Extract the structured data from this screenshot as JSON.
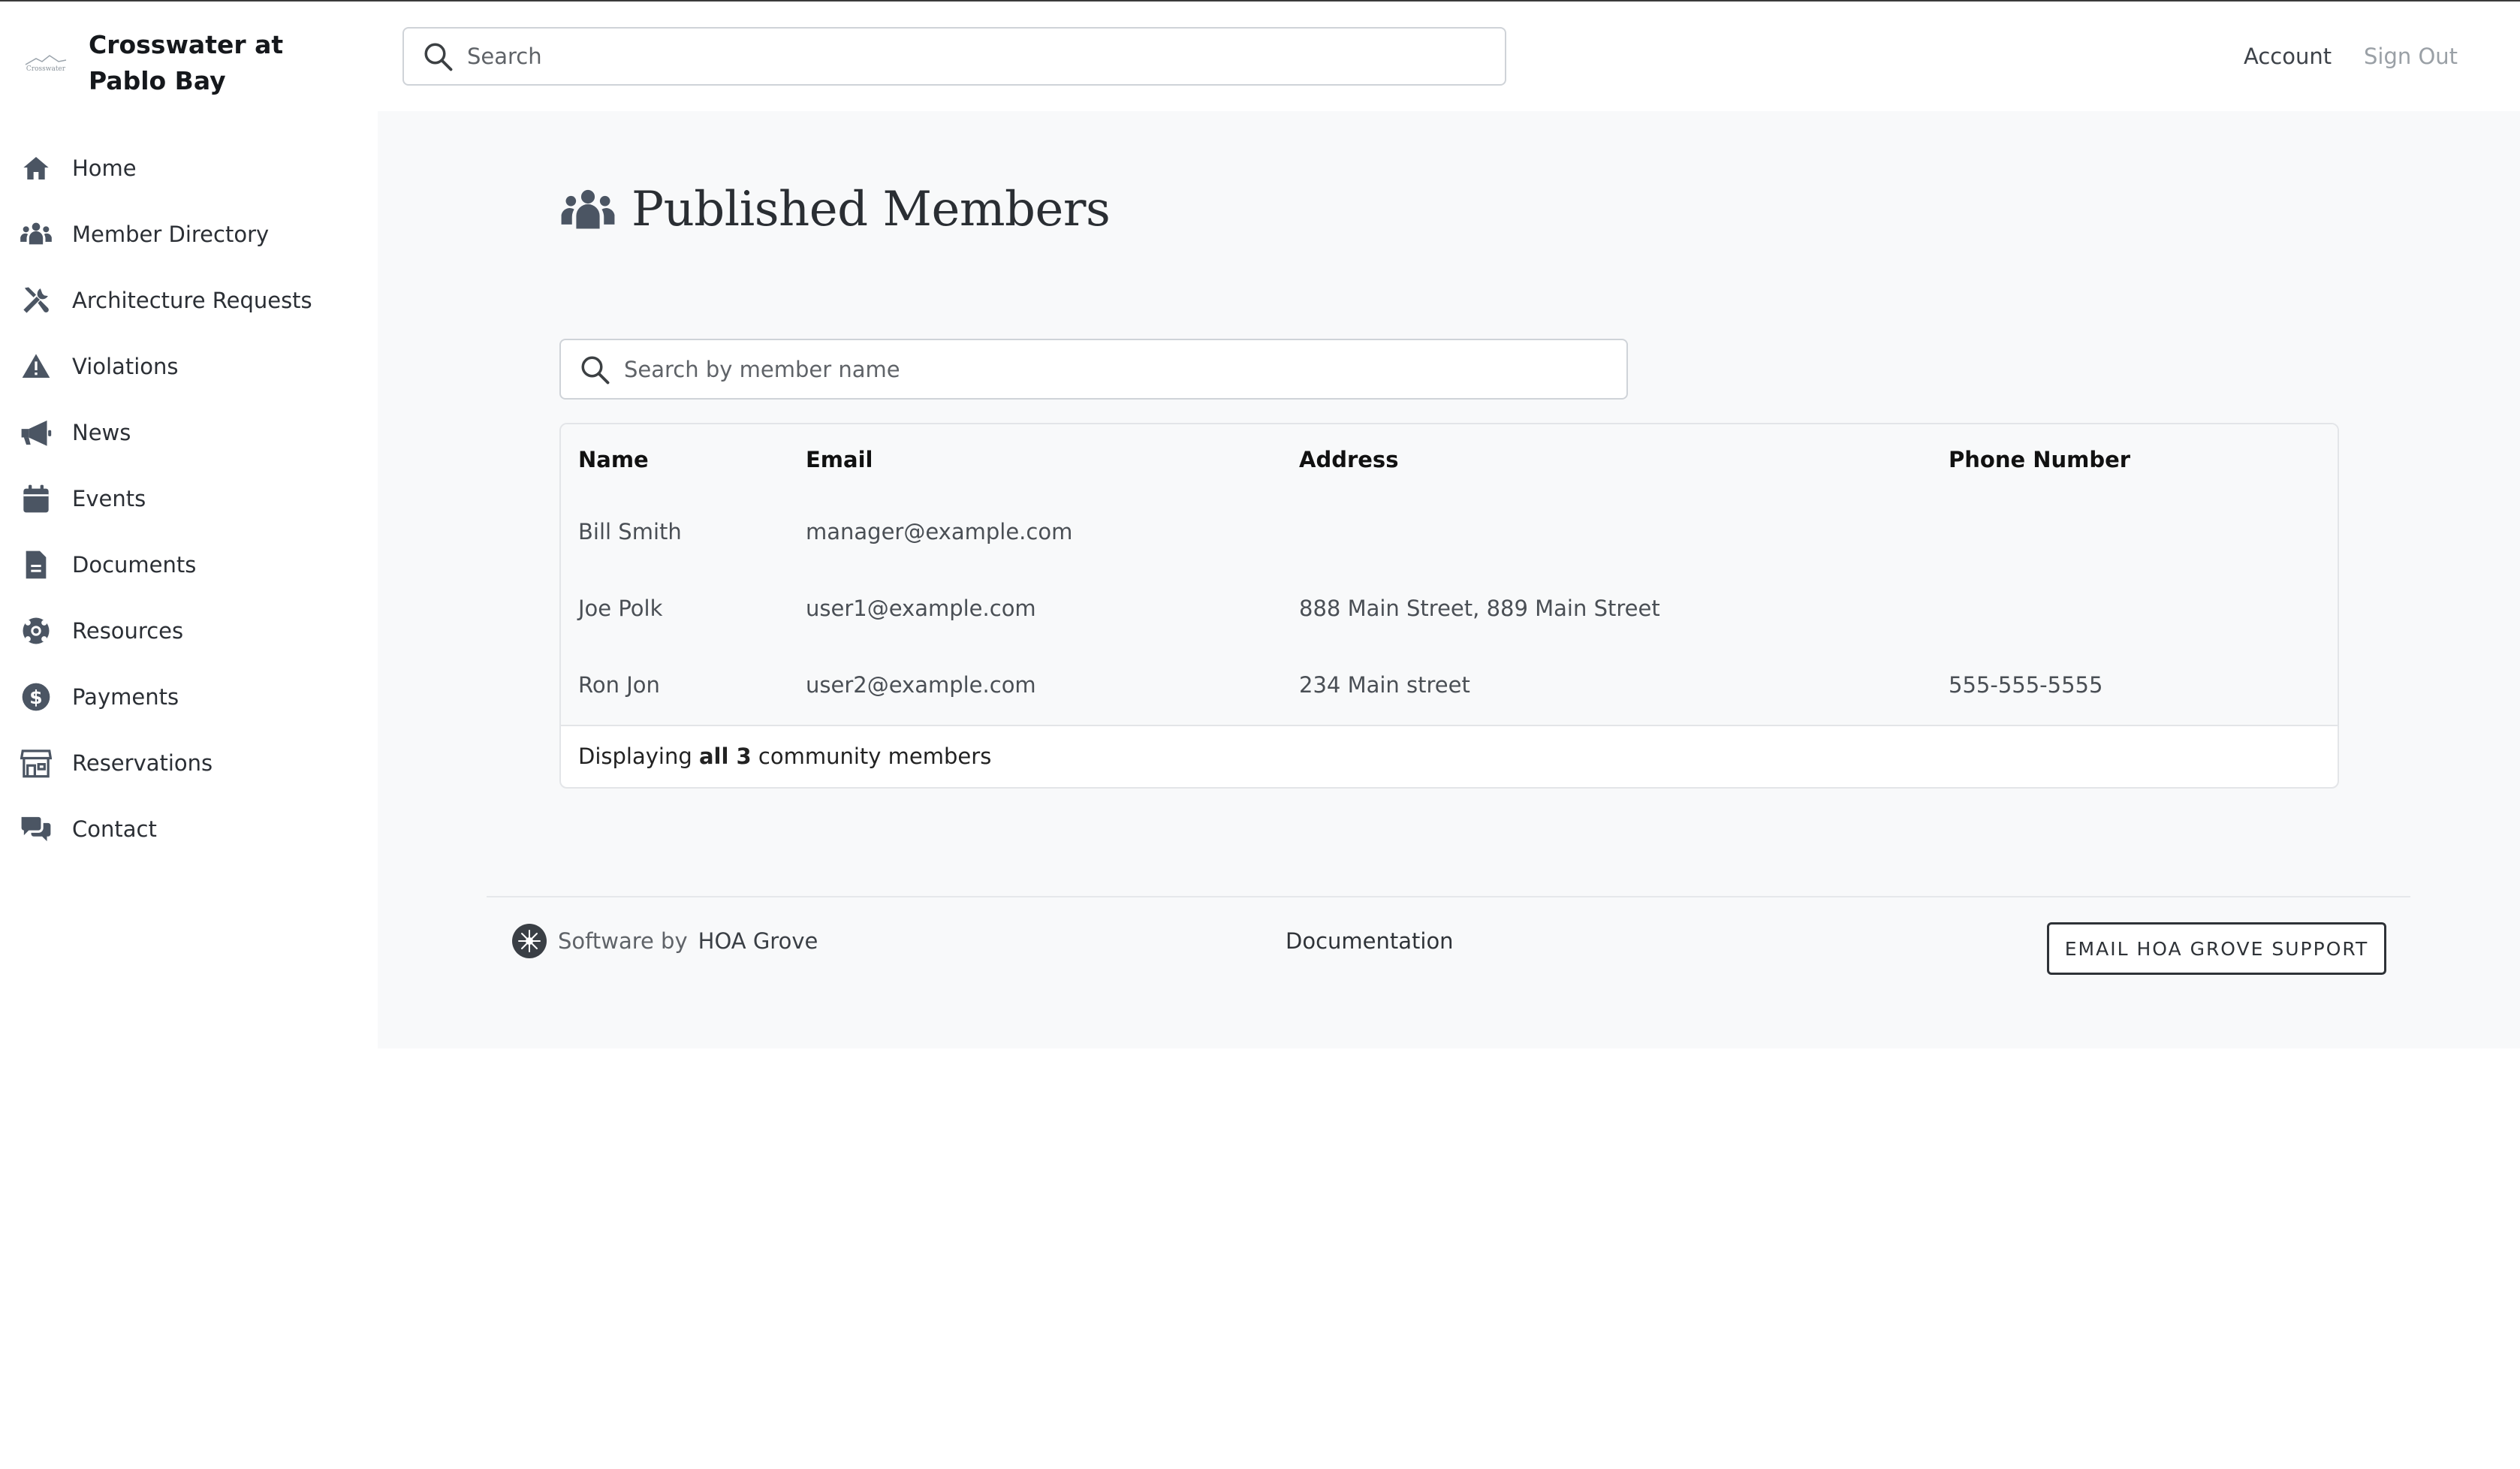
{
  "app": {
    "name": "Crosswater at Pablo Bay",
    "logo_text": "Crosswater"
  },
  "topbar": {
    "search_placeholder": "Search",
    "account": "Account",
    "sign_out": "Sign Out"
  },
  "sidebar": {
    "items": [
      {
        "label": "Home",
        "icon": "home-icon"
      },
      {
        "label": "Member Directory",
        "icon": "people-icon"
      },
      {
        "label": "Architecture Requests",
        "icon": "tools-icon"
      },
      {
        "label": "Violations",
        "icon": "warning-icon"
      },
      {
        "label": "News",
        "icon": "megaphone-icon"
      },
      {
        "label": "Events",
        "icon": "calendar-icon"
      },
      {
        "label": "Documents",
        "icon": "document-icon"
      },
      {
        "label": "Resources",
        "icon": "lifebuoy-icon"
      },
      {
        "label": "Payments",
        "icon": "dollar-icon"
      },
      {
        "label": "Reservations",
        "icon": "store-icon"
      },
      {
        "label": "Contact",
        "icon": "chat-icon"
      }
    ]
  },
  "main": {
    "title": "Published Members",
    "member_search_placeholder": "Search by member name",
    "table": {
      "headers": [
        "Name",
        "Email",
        "Address",
        "Phone Number"
      ],
      "rows": [
        {
          "name": "Bill Smith",
          "email": "manager@example.com",
          "address": "",
          "phone": ""
        },
        {
          "name": "Joe Polk",
          "email": "user1@example.com",
          "address": "888 Main Street, 889 Main Street",
          "phone": ""
        },
        {
          "name": "Ron Jon",
          "email": "user2@example.com",
          "address": "234 Main street",
          "phone": "555-555-5555"
        }
      ],
      "footer": {
        "prefix": "Displaying ",
        "count_text": "all 3",
        "suffix": " community members"
      }
    }
  },
  "footer": {
    "software_by": "Software by",
    "company": "HOA Grove",
    "documentation": "Documentation",
    "support_button": "EMAIL HOA GROVE SUPPORT"
  }
}
